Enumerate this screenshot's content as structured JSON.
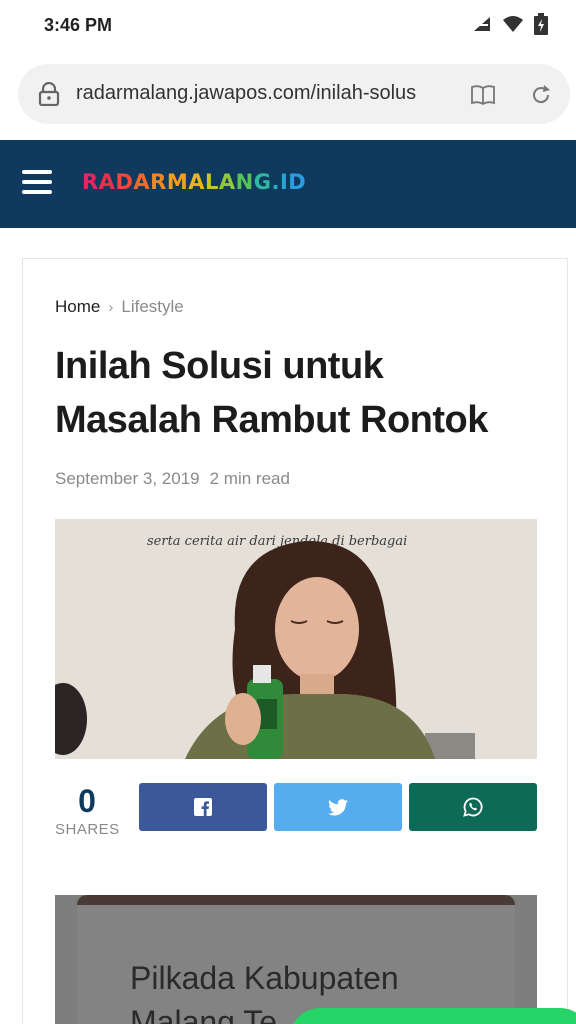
{
  "status_bar": {
    "time": "3:46 PM",
    "icons": [
      "signal-icon",
      "wifi-icon",
      "battery-icon"
    ]
  },
  "browser": {
    "url": "radarmalang.jawapos.com/inilah-solus",
    "icons": [
      "lock-icon",
      "reader-mode-icon",
      "reload-icon"
    ]
  },
  "site": {
    "logo_letters": [
      "R",
      "A",
      "D",
      "A",
      "R",
      "M",
      "A",
      "L",
      "A",
      "N",
      "G",
      ".",
      "I",
      "D"
    ],
    "logo_colors": [
      "#e8265e",
      "#ec2f4b",
      "#f0483a",
      "#f26b2b",
      "#f4871f",
      "#f5a01a",
      "#e9b51c",
      "#c7c52a",
      "#93c83c",
      "#5ac25a",
      "#2fb7a0",
      "#27aec1",
      "#28a6d3",
      "#2a9fe0"
    ],
    "header_color": "#0f3a5e"
  },
  "article": {
    "breadcrumb": {
      "home": "Home",
      "separator": "›",
      "category": "Lifestyle"
    },
    "title": "Inilah Solusi untuk Masalah Rambut Rontok",
    "date": "September 3, 2019",
    "read_time": "2 min read",
    "image_caption_text": "serta cerita air dari jendela di berbagai"
  },
  "share": {
    "count": "0",
    "label": "SHARES",
    "buttons": [
      {
        "name": "facebook",
        "icon": "facebook-icon",
        "color": "#3b5998"
      },
      {
        "name": "twitter",
        "icon": "twitter-icon",
        "color": "#55acee"
      },
      {
        "name": "whatsapp",
        "icon": "whatsapp-icon",
        "color": "#0d6a56"
      }
    ]
  },
  "related": {
    "title": "Pilkada Kabupaten Malang Te"
  }
}
